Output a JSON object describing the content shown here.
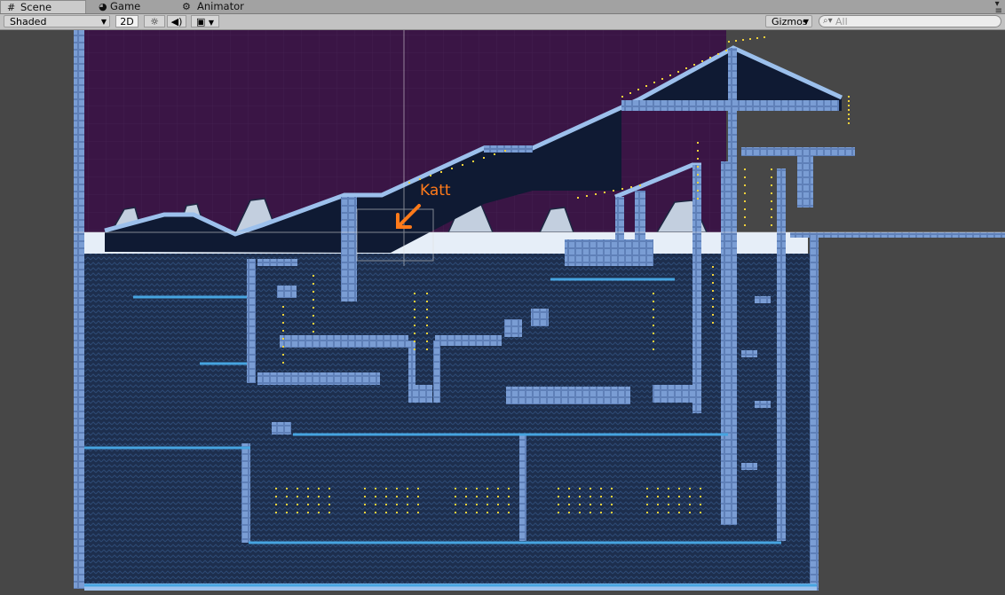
{
  "tabs": [
    {
      "label": "Scene",
      "icon": "grid-icon",
      "active": true
    },
    {
      "label": "Game",
      "icon": "pacman-icon",
      "active": false
    },
    {
      "label": "Animator",
      "icon": "animator-icon",
      "active": false
    }
  ],
  "toolbar": {
    "shading_mode": "Shaded",
    "mode_2d": "2D",
    "lighting_icon": "sun-icon",
    "audio_icon": "speaker-icon",
    "effects_icon": "image-icon",
    "gizmos_label": "Gizmos",
    "search_placeholder": "All"
  },
  "scene": {
    "annotation_label": "Katt",
    "annotation_color": "#ff7a1a",
    "sky_color": "#3a1545",
    "water_color": "#1d2e4d",
    "ice_color": "#6f93cc",
    "snow_color": "#e6eef8"
  }
}
